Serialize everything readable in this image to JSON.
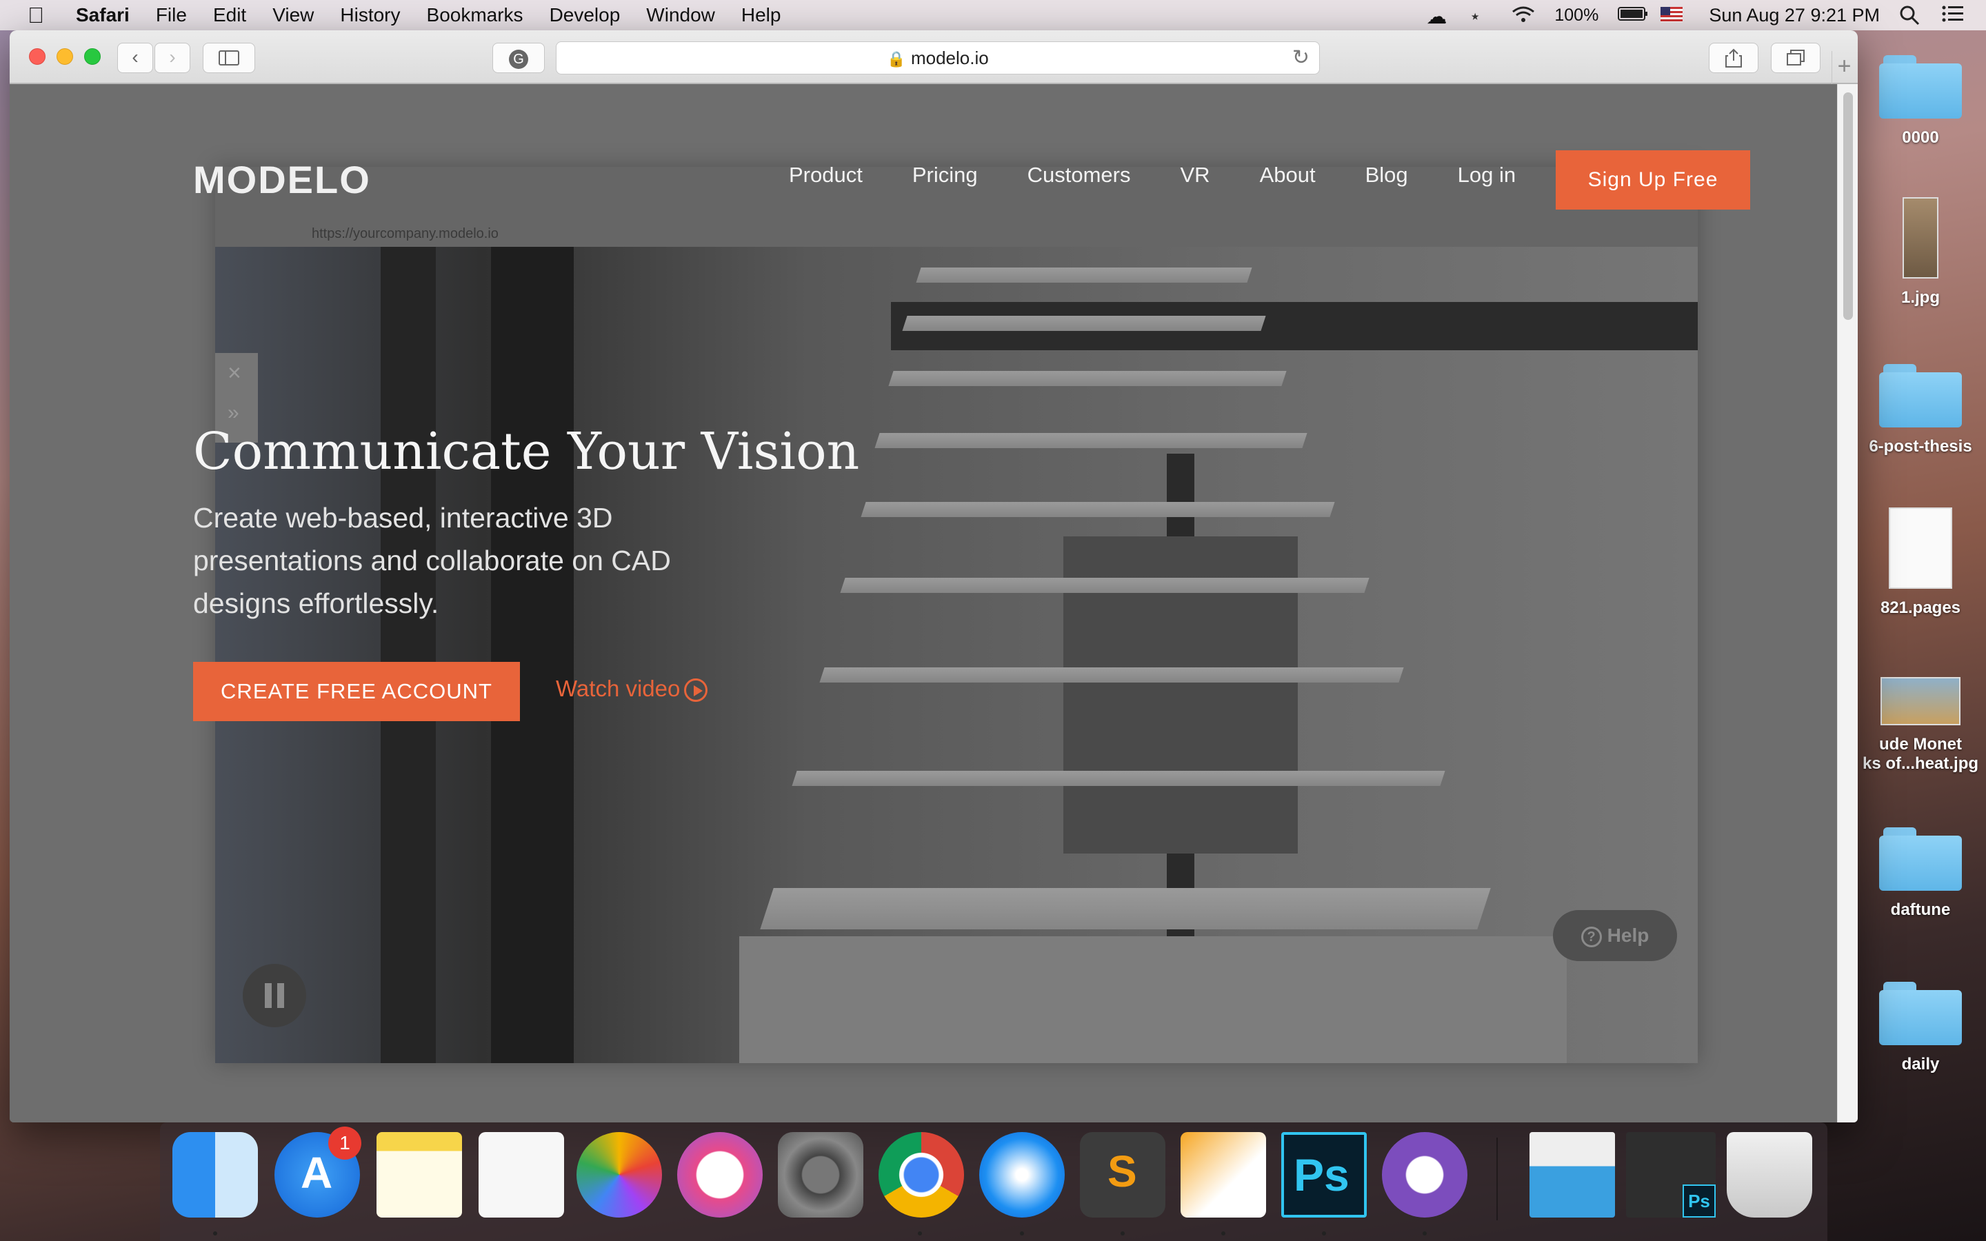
{
  "menubar": {
    "app": "Safari",
    "items": [
      "File",
      "Edit",
      "View",
      "History",
      "Bookmarks",
      "Develop",
      "Window",
      "Help"
    ],
    "battery": "100%",
    "datetime": "Sun Aug 27  9:21 PM"
  },
  "desktop": {
    "items": [
      {
        "label": "0000",
        "icon": "folder-icon"
      },
      {
        "label": "1.jpg",
        "icon": "image-file-icon"
      },
      {
        "label": "6-post-thesis",
        "icon": "folder-icon"
      },
      {
        "label": "821.pages",
        "icon": "document-icon"
      },
      {
        "label": "ude Monet",
        "label2": "ks of...heat.jpg",
        "icon": "image-file-icon"
      },
      {
        "label": "daftune",
        "icon": "folder-icon"
      },
      {
        "label": "daily",
        "icon": "folder-icon"
      }
    ]
  },
  "browser": {
    "url": "modelo.io",
    "colors": {
      "accent": "#e8643a"
    }
  },
  "site": {
    "logo": "MODELO",
    "nav": [
      "Product",
      "Pricing",
      "Customers",
      "VR",
      "About",
      "Blog",
      "Log in"
    ],
    "signup": "Sign Up Free",
    "scene_url": "https://yourcompany.modelo.io",
    "hero": {
      "title": "Communicate Your Vision",
      "subtitle": "Create web-based, interactive 3D presentations and collaborate on CAD designs effortlessly.",
      "cta": "CREATE FREE ACCOUNT",
      "watch": "Watch video"
    },
    "help": "Help"
  },
  "dock": {
    "apps": [
      "Finder",
      "App Store",
      "Notes",
      "Reminders",
      "Photos",
      "iTunes",
      "System Preferences",
      "Chrome",
      "Safari",
      "Sublime Text",
      "Pages",
      "Photoshop",
      "GitHub Desktop",
      "Preview",
      "Photoshop Document",
      "Trash"
    ],
    "app_store_badge": "1"
  }
}
